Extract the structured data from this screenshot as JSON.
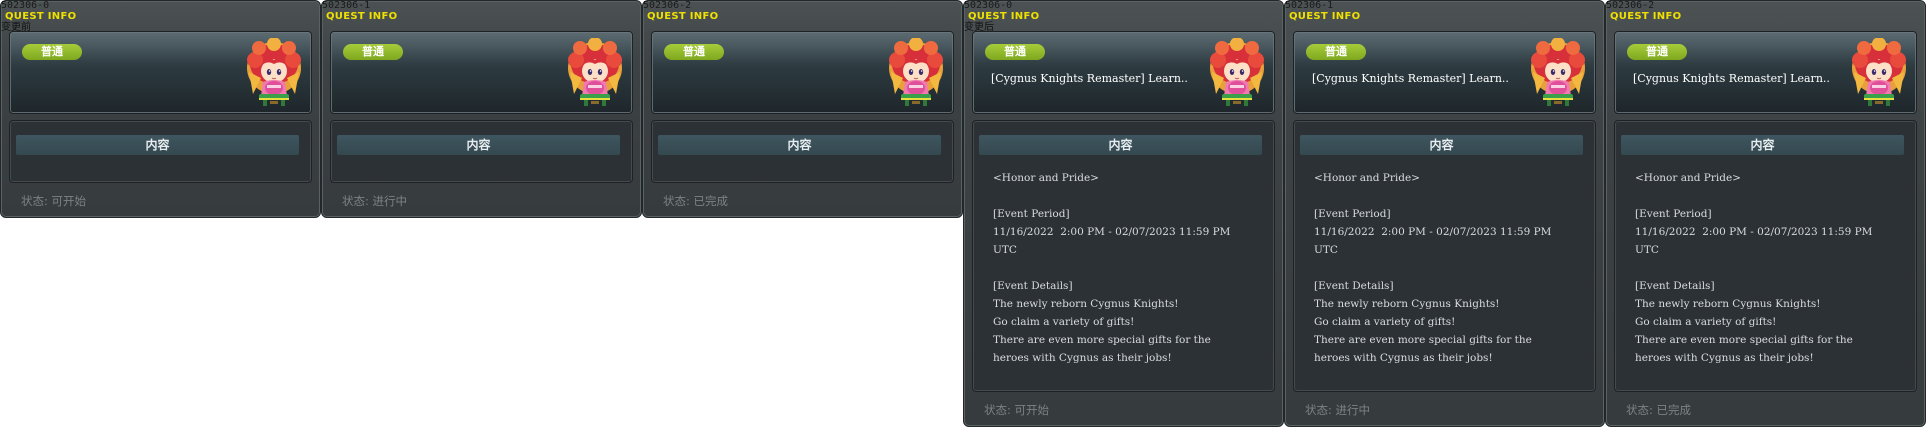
{
  "colors": {
    "title": "#f0e000",
    "badge": "#94bd2b",
    "status": "#7c8285"
  },
  "panels": [
    {
      "id": "502306-0",
      "title": "QUEST INFO",
      "note": "变更前",
      "badge": "普通",
      "name": "",
      "content_tab": "内容",
      "description": "",
      "status_label": "状态:",
      "status_value": "可开始",
      "npc_icon": "npc-portrait-icon"
    },
    {
      "id": "502306-1",
      "title": "QUEST INFO",
      "note": "",
      "badge": "普通",
      "name": "",
      "content_tab": "内容",
      "description": "",
      "status_label": "状态:",
      "status_value": "进行中",
      "npc_icon": "npc-portrait-icon"
    },
    {
      "id": "502306-2",
      "title": "QUEST INFO",
      "note": "",
      "badge": "普通",
      "name": "",
      "content_tab": "内容",
      "description": "",
      "status_label": "状态:",
      "status_value": "已完成",
      "npc_icon": "npc-portrait-icon"
    },
    {
      "id": "502306-0",
      "title": "QUEST INFO",
      "note": "变更后",
      "badge": "普通",
      "name": "[Cygnus Knights Remaster] Learn..",
      "content_tab": "内容",
      "description": "<Honor and Pride>\n\n[Event Period]\n11/16/2022  2:00 PM - 02/07/2023 11:59 PM\nUTC\n\n[Event Details]\nThe newly reborn Cygnus Knights!\nGo claim a variety of gifts!\nThere are even more special gifts for the\nheroes with Cygnus as their jobs!",
      "status_label": "状态:",
      "status_value": "可开始",
      "npc_icon": "npc-portrait-icon"
    },
    {
      "id": "502306-1",
      "title": "QUEST INFO",
      "note": "",
      "badge": "普通",
      "name": "[Cygnus Knights Remaster] Learn..",
      "content_tab": "内容",
      "description": "<Honor and Pride>\n\n[Event Period]\n11/16/2022  2:00 PM - 02/07/2023 11:59 PM\nUTC\n\n[Event Details]\nThe newly reborn Cygnus Knights!\nGo claim a variety of gifts!\nThere are even more special gifts for the\nheroes with Cygnus as their jobs!",
      "status_label": "状态:",
      "status_value": "进行中",
      "npc_icon": "npc-portrait-icon"
    },
    {
      "id": "502306-2",
      "title": "QUEST INFO",
      "note": "",
      "badge": "普通",
      "name": "[Cygnus Knights Remaster] Learn..",
      "content_tab": "内容",
      "description": "<Honor and Pride>\n\n[Event Period]\n11/16/2022  2:00 PM - 02/07/2023 11:59 PM\nUTC\n\n[Event Details]\nThe newly reborn Cygnus Knights!\nGo claim a variety of gifts!\nThere are even more special gifts for the\nheroes with Cygnus as their jobs!",
      "status_label": "状态:",
      "status_value": "已完成",
      "npc_icon": "npc-portrait-icon"
    }
  ]
}
